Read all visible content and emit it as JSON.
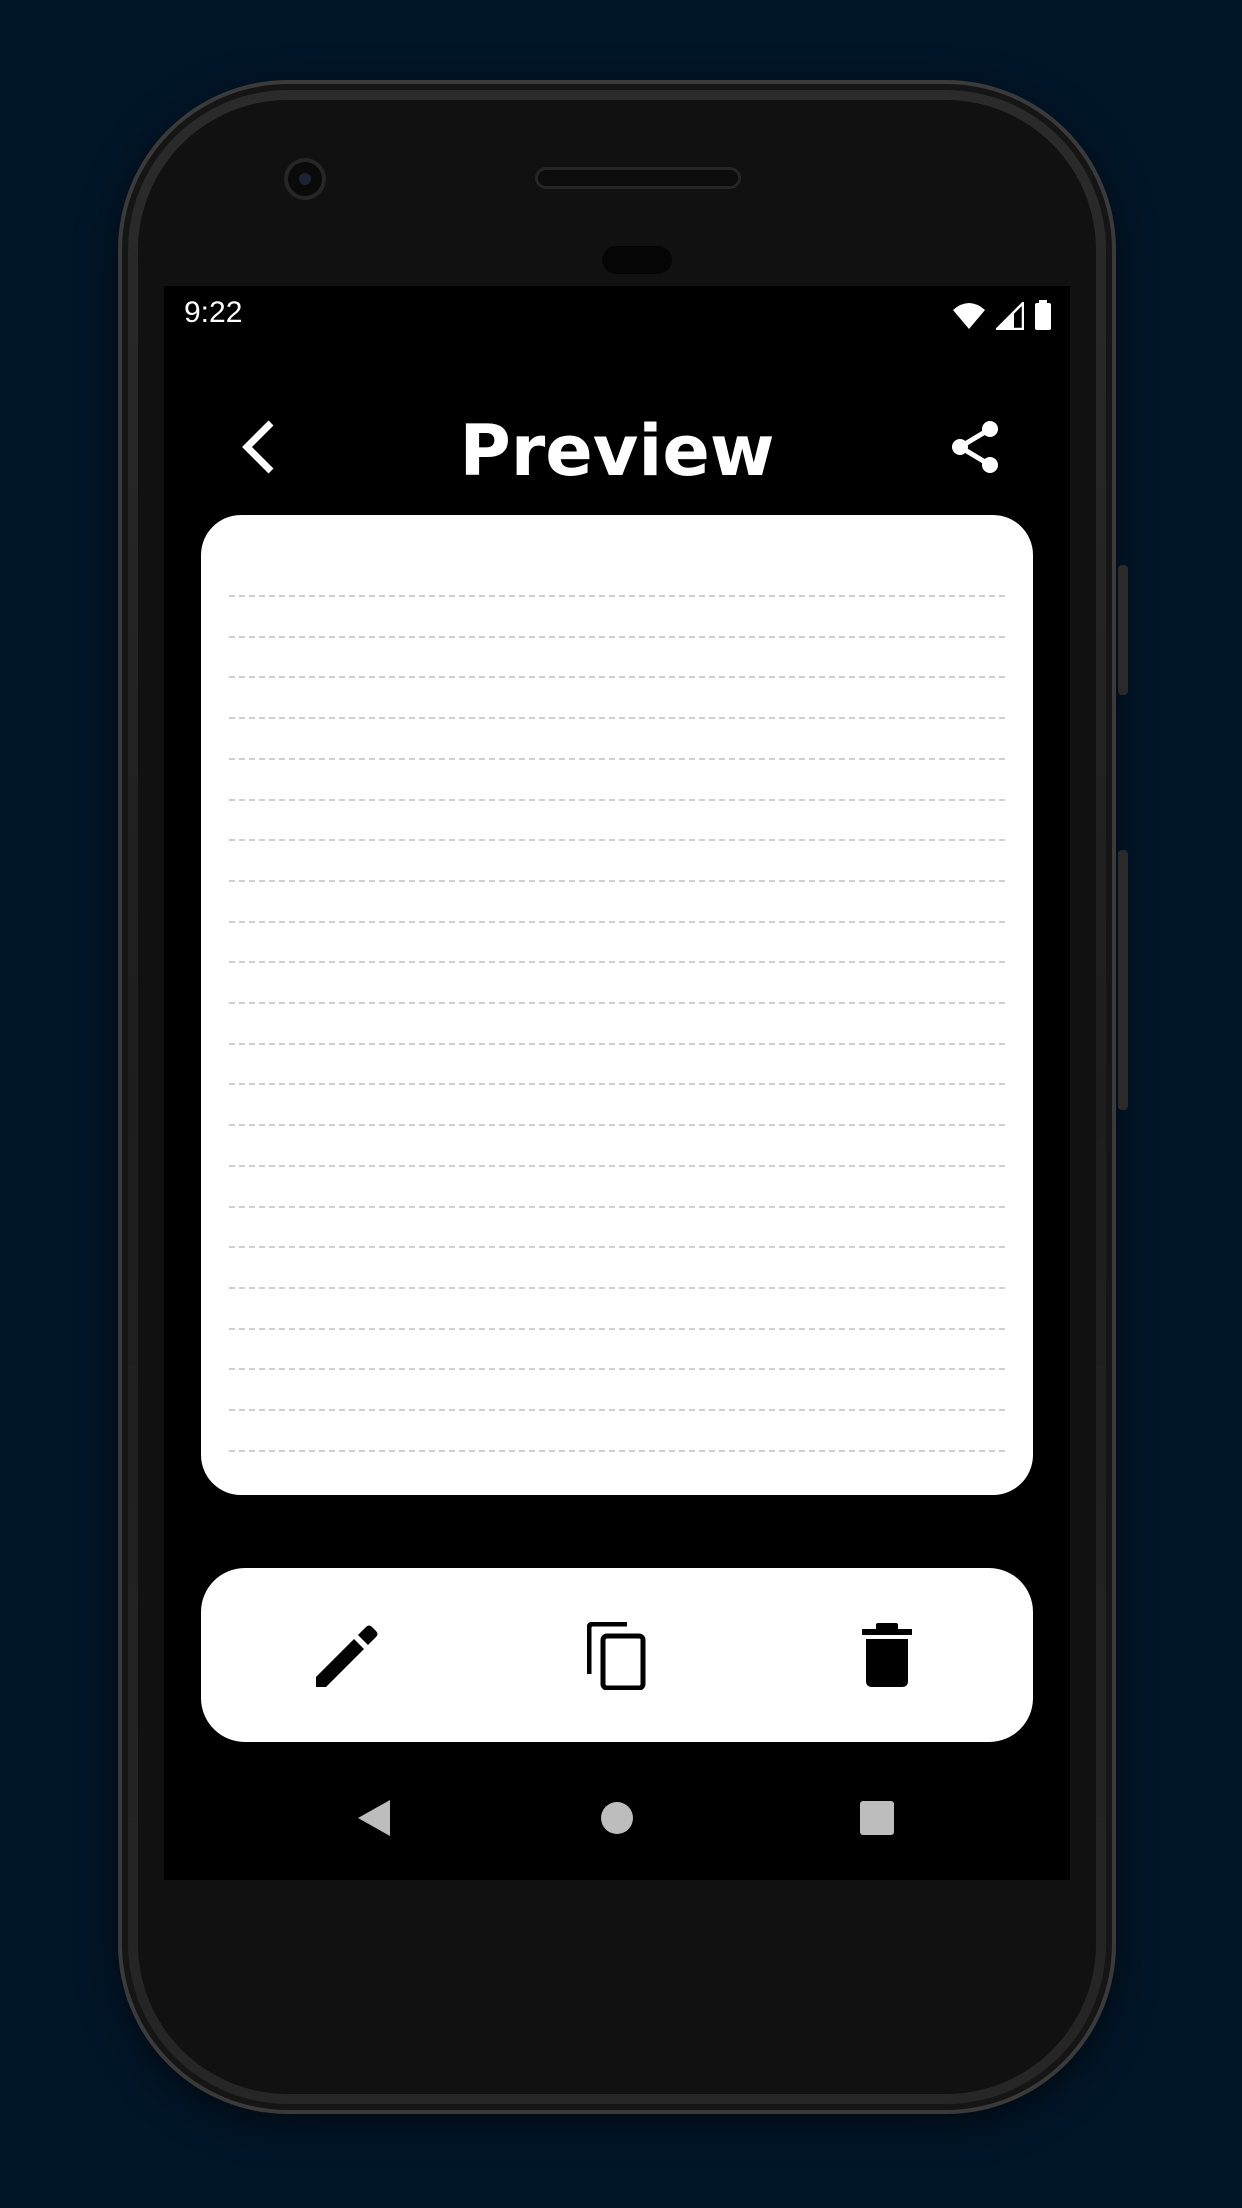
{
  "status_bar": {
    "time": "9:22"
  },
  "header": {
    "title": "Preview",
    "back_icon": "chevron-left-icon",
    "share_icon": "share-icon"
  },
  "preview": {
    "ruled_line_count": 22
  },
  "actions": [
    {
      "name": "edit",
      "icon": "pencil-icon"
    },
    {
      "name": "copy",
      "icon": "copy-icon"
    },
    {
      "name": "delete",
      "icon": "trash-icon"
    }
  ],
  "colors": {
    "background": "#021629",
    "screen": "#000000",
    "card": "#ffffff",
    "ruled_line": "#cfcfcf"
  }
}
